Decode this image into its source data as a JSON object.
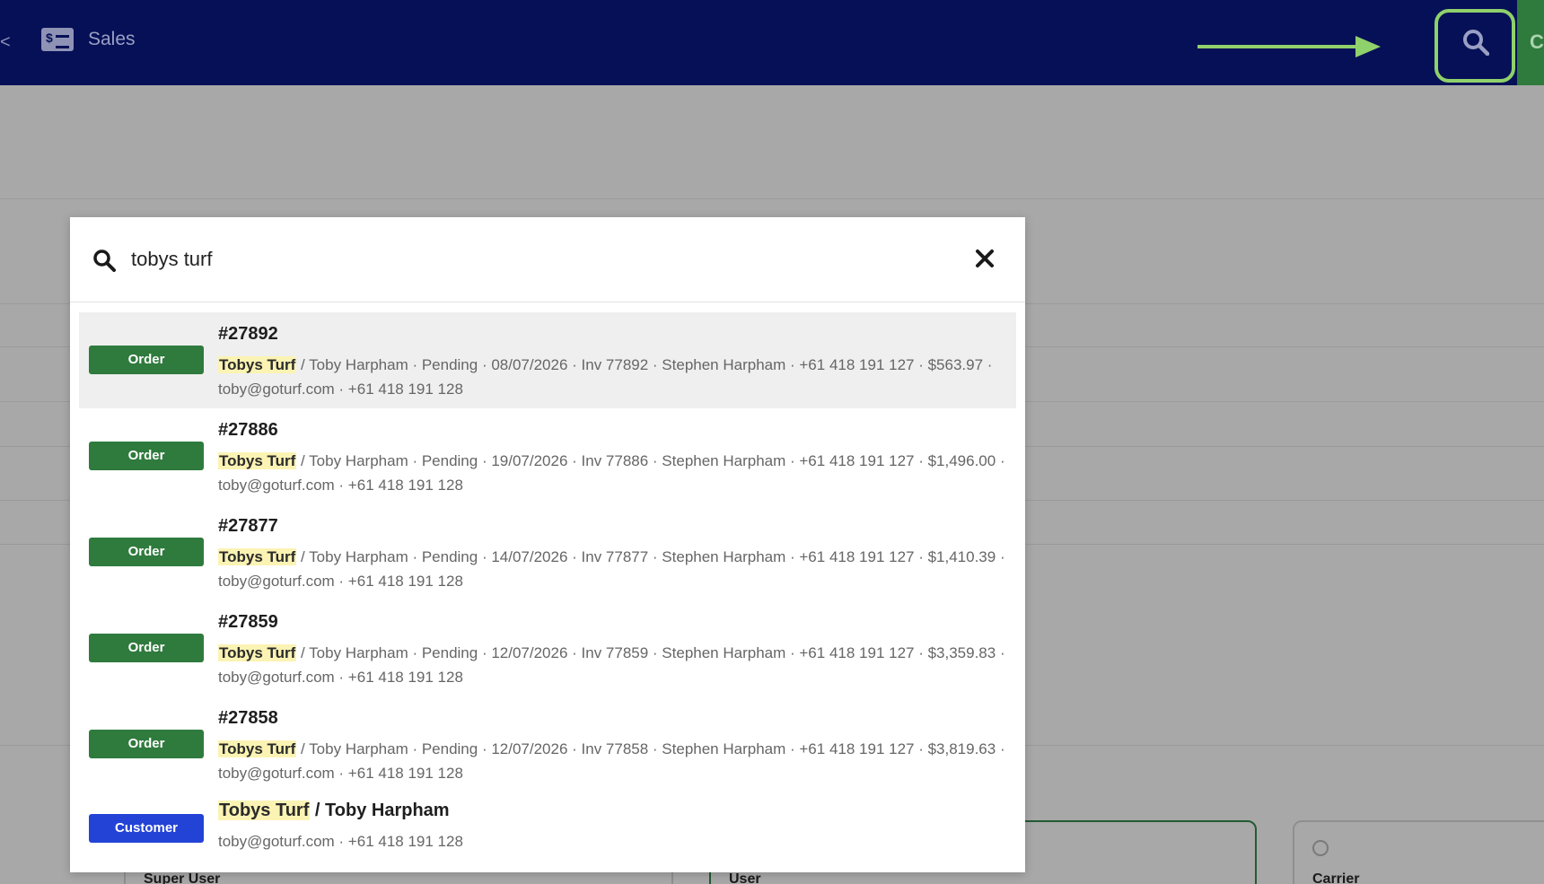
{
  "topbar": {
    "edge_glyph": "<",
    "nav_sales_label": "Sales",
    "cta_label_partial": "C"
  },
  "colors": {
    "nav_bg": "#061057",
    "order_badge": "#2f7a3d",
    "customer_badge": "#2343d6",
    "highlight": "#fbf3b3",
    "annotation": "#8fd16a"
  },
  "background": {
    "cards": [
      "Super User",
      "User",
      "Carrier"
    ]
  },
  "search": {
    "query": "tobys turf",
    "results": [
      {
        "type": "Order",
        "title": "#27892",
        "match": "Tobys Turf",
        "rest": " / Toby Harpham · Pending · 08/07/2026 · Inv 77892 · Stephen Harpham · +61 418 191 127 · $563.97 · toby@goturf.com · +61 418 191 128"
      },
      {
        "type": "Order",
        "title": "#27886",
        "match": "Tobys Turf",
        "rest": " / Toby Harpham · Pending · 19/07/2026 · Inv 77886 · Stephen Harpham · +61 418 191 127 · $1,496.00 · toby@goturf.com · +61 418 191 128"
      },
      {
        "type": "Order",
        "title": "#27877",
        "match": "Tobys Turf",
        "rest": " / Toby Harpham · Pending · 14/07/2026 · Inv 77877 · Stephen Harpham · +61 418 191 127 · $1,410.39 · toby@goturf.com · +61 418 191 128"
      },
      {
        "type": "Order",
        "title": "#27859",
        "match": "Tobys Turf",
        "rest": " / Toby Harpham · Pending · 12/07/2026 · Inv 77859 · Stephen Harpham · +61 418 191 127 · $3,359.83 · toby@goturf.com · +61 418 191 128"
      },
      {
        "type": "Order",
        "title": "#27858",
        "match": "Tobys Turf",
        "rest": " / Toby Harpham · Pending · 12/07/2026 · Inv 77858 · Stephen Harpham · +61 418 191 127 · $3,819.63 · toby@goturf.com · +61 418 191 128"
      }
    ],
    "customer": {
      "type": "Customer",
      "title_match": "Tobys Turf",
      "title_rest": " / Toby Harpham",
      "desc": "toby@goturf.com · +61 418 191 128"
    }
  }
}
